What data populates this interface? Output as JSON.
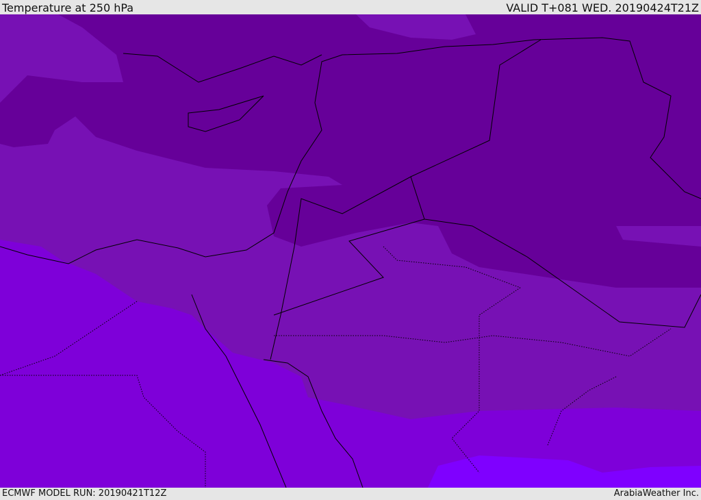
{
  "header": {
    "title": "Temperature at 250 hPa",
    "valid": "VALID T+081 WED. 20190424T21Z"
  },
  "footer": {
    "model_run": "ECMWF MODEL RUN: 20190421T12Z",
    "credit": "ArabiaWeather Inc."
  },
  "colors": {
    "cold_dark": "#660099",
    "cold_mid": "#7711b4",
    "warm_mid": "#7e00d9",
    "warm_light": "#7f00ff",
    "borders": "#000000"
  }
}
